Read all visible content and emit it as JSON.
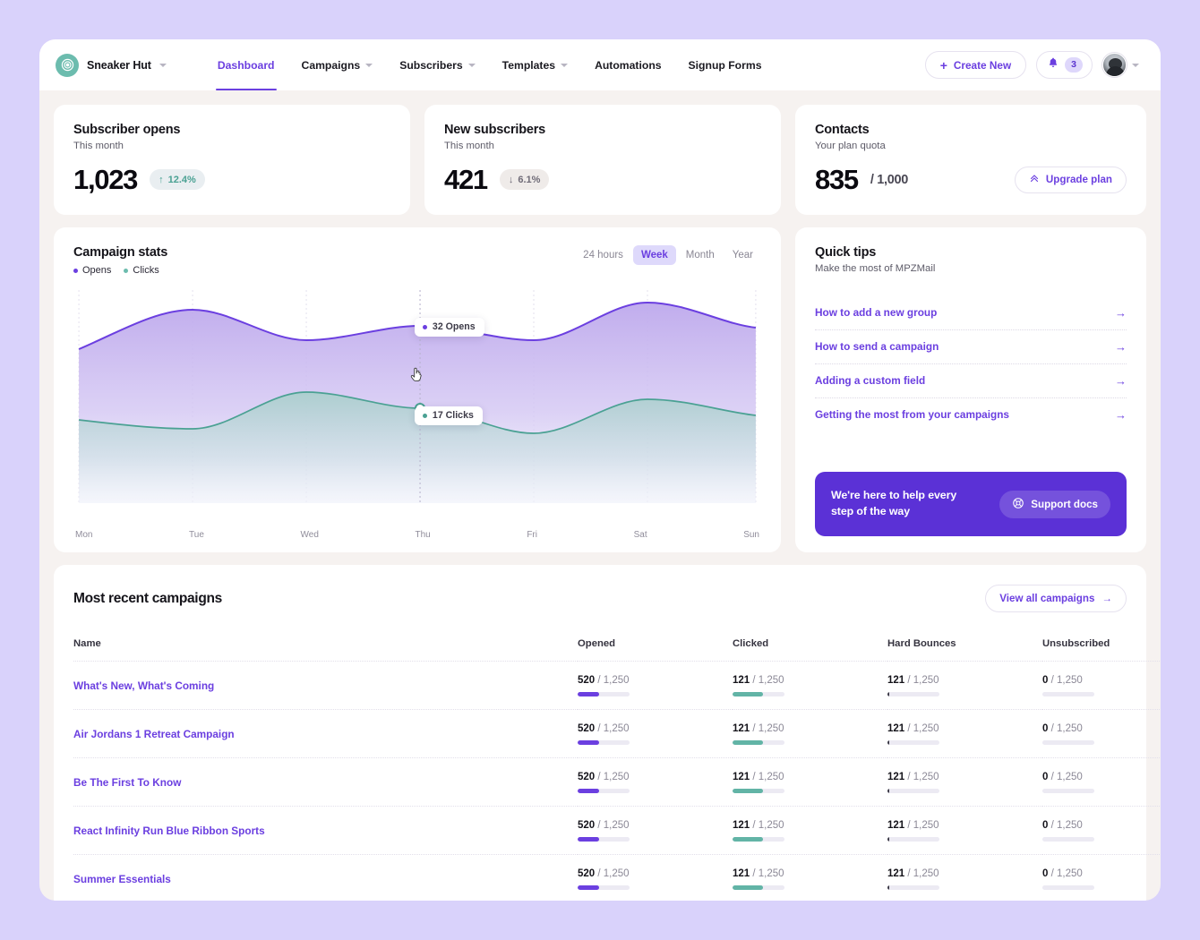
{
  "theme": {
    "page_bg": "#d9d2fb",
    "shell_bg": "#f6f2f0",
    "accent_purple": "#6b3fe0",
    "accent_teal": "#4aa193",
    "banner_purple": "#5b31d6"
  },
  "header": {
    "brand": {
      "name": "Sneaker Hut",
      "logo_icon": "target-rings-icon",
      "caret_icon": "chevron-down-icon"
    },
    "nav": [
      {
        "label": "Dashboard",
        "active": true,
        "has_caret": false
      },
      {
        "label": "Campaigns",
        "active": false,
        "has_caret": true
      },
      {
        "label": "Subscribers",
        "active": false,
        "has_caret": true
      },
      {
        "label": "Templates",
        "active": false,
        "has_caret": true
      },
      {
        "label": "Automations",
        "active": false,
        "has_caret": false
      },
      {
        "label": "Signup Forms",
        "active": false,
        "has_caret": false
      }
    ],
    "create_new_label": "Create New",
    "create_new_icon": "plus-icon",
    "notification_icon": "bell-icon",
    "notification_count": "3",
    "avatar_icon": "user-avatar",
    "avatar_caret_icon": "chevron-down-icon"
  },
  "stats": [
    {
      "title": "Subscriber opens",
      "subtitle": "This month",
      "value": "1,023",
      "delta": "12.4%",
      "delta_direction": "up",
      "delta_icon": "arrow-up-icon"
    },
    {
      "title": "New subscribers",
      "subtitle": "This month",
      "value": "421",
      "delta": "6.1%",
      "delta_direction": "down",
      "delta_icon": "arrow-down-icon"
    },
    {
      "title": "Contacts",
      "subtitle": "Your plan quota",
      "value": "835",
      "quota": "/ 1,000",
      "upgrade_label": "Upgrade plan",
      "upgrade_icon": "chevrons-up-icon"
    }
  ],
  "campaign_stats": {
    "title": "Campaign stats",
    "legend": [
      {
        "label": "Opens",
        "color": "#6b3fe0"
      },
      {
        "label": "Clicks",
        "color": "#4aa193"
      }
    ],
    "ranges": [
      {
        "label": "24 hours",
        "active": false
      },
      {
        "label": "Week",
        "active": true
      },
      {
        "label": "Month",
        "active": false
      },
      {
        "label": "Year",
        "active": false
      }
    ],
    "tooltips": [
      {
        "label": "32 Opens",
        "color": "#6b3fe0"
      },
      {
        "label": "17 Clicks",
        "color": "#4aa193"
      }
    ]
  },
  "chart_data": {
    "type": "area",
    "title": "Campaign stats",
    "xlabel": "",
    "ylabel": "",
    "grid": true,
    "legend_position": "top-left",
    "categories": [
      "Mon",
      "Tue",
      "Wed",
      "Thu",
      "Fri",
      "Sat",
      "Sun"
    ],
    "series": [
      {
        "name": "Opens",
        "color": "#6b3fe0",
        "values": [
          24,
          34,
          28,
          32,
          28,
          36,
          31
        ]
      },
      {
        "name": "Clicks",
        "color": "#4aa193",
        "values": [
          15,
          13,
          20,
          17,
          12,
          19,
          16
        ]
      }
    ],
    "highlighted_point": {
      "x": "Thu",
      "opens": 32,
      "clicks": 17
    },
    "ylim": [
      0,
      45
    ]
  },
  "quick_tips": {
    "title": "Quick tips",
    "subtitle": "Make the most of MPZMail",
    "items": [
      {
        "label": "How to add a new group",
        "arrow_icon": "arrow-right-icon"
      },
      {
        "label": "How to send a campaign",
        "arrow_icon": "arrow-right-icon"
      },
      {
        "label": "Adding a custom field",
        "arrow_icon": "arrow-right-icon"
      },
      {
        "label": "Getting the most from your campaigns",
        "arrow_icon": "arrow-right-icon"
      }
    ],
    "banner": {
      "line1": "We're here to help every",
      "line2": "step of the way",
      "button_label": "Support docs",
      "button_icon": "lifebuoy-icon"
    }
  },
  "recent_campaigns": {
    "title": "Most recent campaigns",
    "view_all_label": "View all campaigns",
    "view_all_icon": "arrow-right-icon",
    "columns": [
      "Name",
      "Opened",
      "Clicked",
      "Hard Bounces",
      "Unsubscribed"
    ],
    "rows": [
      {
        "name": "What's New, What's Coming",
        "opened": {
          "value": "520",
          "total": "/ 1,250",
          "pct": 41.6,
          "color": "#6b3fe0"
        },
        "clicked": {
          "value": "121",
          "total": "/ 1,250",
          "pct": 58.0,
          "color": "#62b4a6"
        },
        "bounces": {
          "value": "121",
          "total": "/ 1,250",
          "pct": 3.0,
          "color": "#3b3946"
        },
        "unsubscribed": {
          "value": "0",
          "total": "/ 1,250",
          "pct": 0,
          "color": "#6b3fe0"
        }
      },
      {
        "name": "Air Jordans 1 Retreat Campaign",
        "opened": {
          "value": "520",
          "total": "/ 1,250",
          "pct": 41.6,
          "color": "#6b3fe0"
        },
        "clicked": {
          "value": "121",
          "total": "/ 1,250",
          "pct": 58.0,
          "color": "#62b4a6"
        },
        "bounces": {
          "value": "121",
          "total": "/ 1,250",
          "pct": 3.0,
          "color": "#3b3946"
        },
        "unsubscribed": {
          "value": "0",
          "total": "/ 1,250",
          "pct": 0,
          "color": "#6b3fe0"
        }
      },
      {
        "name": "Be The First To Know",
        "opened": {
          "value": "520",
          "total": "/ 1,250",
          "pct": 41.6,
          "color": "#6b3fe0"
        },
        "clicked": {
          "value": "121",
          "total": "/ 1,250",
          "pct": 58.0,
          "color": "#62b4a6"
        },
        "bounces": {
          "value": "121",
          "total": "/ 1,250",
          "pct": 3.0,
          "color": "#3b3946"
        },
        "unsubscribed": {
          "value": "0",
          "total": "/ 1,250",
          "pct": 0,
          "color": "#6b3fe0"
        }
      },
      {
        "name": "React Infinity Run Blue Ribbon Sports",
        "opened": {
          "value": "520",
          "total": "/ 1,250",
          "pct": 41.6,
          "color": "#6b3fe0"
        },
        "clicked": {
          "value": "121",
          "total": "/ 1,250",
          "pct": 58.0,
          "color": "#62b4a6"
        },
        "bounces": {
          "value": "121",
          "total": "/ 1,250",
          "pct": 3.0,
          "color": "#3b3946"
        },
        "unsubscribed": {
          "value": "0",
          "total": "/ 1,250",
          "pct": 0,
          "color": "#6b3fe0"
        }
      },
      {
        "name": "Summer Essentials",
        "opened": {
          "value": "520",
          "total": "/ 1,250",
          "pct": 41.6,
          "color": "#6b3fe0"
        },
        "clicked": {
          "value": "121",
          "total": "/ 1,250",
          "pct": 58.0,
          "color": "#62b4a6"
        },
        "bounces": {
          "value": "121",
          "total": "/ 1,250",
          "pct": 3.0,
          "color": "#3b3946"
        },
        "unsubscribed": {
          "value": "0",
          "total": "/ 1,250",
          "pct": 0,
          "color": "#6b3fe0"
        }
      }
    ]
  }
}
